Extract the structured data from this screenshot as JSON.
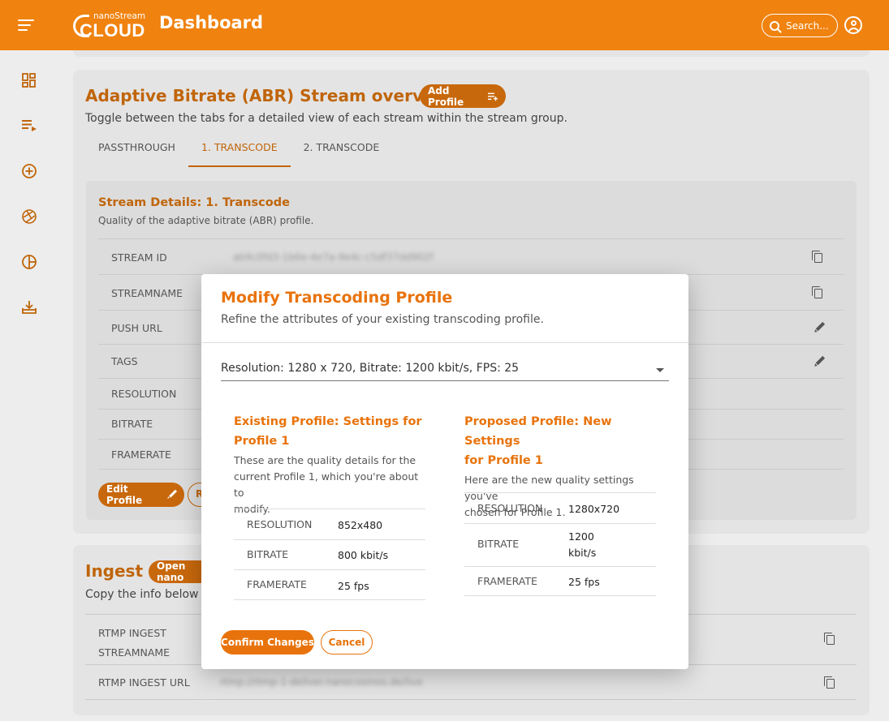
{
  "header": {
    "logo_small": "nanoStream",
    "logo_big": "CLOUD",
    "title": "Dashboard",
    "search_placeholder": "Search..."
  },
  "sidebar": {
    "items": [
      {
        "icon": "dashboard-icon"
      },
      {
        "icon": "playlist-play-icon"
      },
      {
        "icon": "add-circle-icon"
      },
      {
        "icon": "aperture-icon"
      },
      {
        "icon": "analytics-icon"
      },
      {
        "icon": "download-tray-icon"
      }
    ]
  },
  "abr": {
    "title": "Adaptive Bitrate (ABR) Stream overview",
    "add_profile": "Add Profile",
    "subtitle": "Toggle between the tabs for a detailed view of each stream within the stream group.",
    "tabs": [
      "PASSTHROUGH",
      "1. TRANSCODE",
      "2. TRANSCODE"
    ],
    "active_tab": 1,
    "details_title": "Stream Details: 1. Transcode",
    "details_sub": "Quality of the adaptive bitrate (ABR) profile.",
    "rows": [
      {
        "label": "STREAM ID",
        "value": "ab9c0fd3-1b6e-4e7a-9e4c-c5df37dd902f"
      },
      {
        "label": "STREAMNAME",
        "value": ""
      },
      {
        "label": "PUSH URL",
        "value": ""
      },
      {
        "label": "TAGS",
        "value": ""
      },
      {
        "label": "RESOLUTION",
        "value": ""
      },
      {
        "label": "BITRATE",
        "value": ""
      },
      {
        "label": "FRAMERATE",
        "value": ""
      }
    ],
    "edit_profile": "Edit Profile",
    "second_button_fragment": "R"
  },
  "ingest": {
    "title": "Ingest",
    "open_button": "Open nano",
    "subtitle": "Copy the info below to",
    "rows": [
      {
        "label_line1": "RTMP INGEST",
        "label_line2": "STREAMNAME",
        "value": ""
      },
      {
        "label_line1": "RTMP INGEST URL",
        "label_line2": "",
        "value": "rtmp://rtmp-1-deliver.nanocosmos.de/live"
      }
    ]
  },
  "modal": {
    "title": "Modify Transcoding Profile",
    "subtitle": "Refine the attributes of your existing transcoding profile.",
    "selected_option": "Resolution: 1280 x 720, Bitrate: 1200 kbit/s, FPS: 25",
    "existing": {
      "title_line1": "Existing Profile: Settings for",
      "title_line2": "Profile 1",
      "desc_line1": "These are the quality details for the",
      "desc_line2": "current Profile 1, which you're about to",
      "desc_line3": "modify.",
      "rows": [
        {
          "label": "RESOLUTION",
          "value": "852x480"
        },
        {
          "label": "BITRATE",
          "value": "800 kbit/s"
        },
        {
          "label": "FRAMERATE",
          "value": "25 fps"
        }
      ]
    },
    "proposed": {
      "title_line1": "Proposed Profile: New Settings",
      "title_line2": "for Profile 1",
      "desc_line1": "Here are the new quality settings you've",
      "desc_line2": "chosen for Profile 1.",
      "rows": [
        {
          "label": "RESOLUTION",
          "value": "1280x720"
        },
        {
          "label": "BITRATE",
          "value_line1": "1200",
          "value_line2": "kbit/s"
        },
        {
          "label": "FRAMERATE",
          "value": "25 fps"
        }
      ]
    },
    "confirm": "Confirm Changes",
    "cancel": "Cancel"
  },
  "colors": {
    "brand": "#f0820f",
    "accent": "#e8730c",
    "accent_dark": "#c0650a"
  }
}
